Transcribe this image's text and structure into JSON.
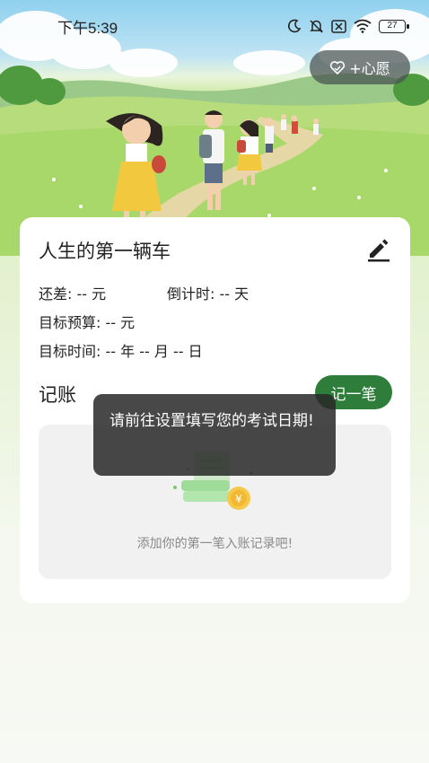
{
  "status_bar": {
    "time": "下午5:39",
    "battery": "27",
    "icons": [
      "moon-icon",
      "bell-muted-icon",
      "sim-off-icon",
      "wifi-icon",
      "battery-icon"
    ]
  },
  "header": {
    "wish_button_label": "+心愿",
    "wish_icon": "heart-icon"
  },
  "goal": {
    "title": "人生的第一辆车",
    "edit_icon": "edit-icon",
    "remaining_label": "还差:",
    "remaining_value": "-- 元",
    "countdown_label": "倒计时:",
    "countdown_value": "-- 天",
    "budget_label": "目标预算:",
    "budget_value": "-- 元",
    "date_label": "目标时间:",
    "date_value": "-- 年 -- 月 -- 日"
  },
  "ledger": {
    "title": "记账",
    "record_button_label": "记一笔",
    "empty_text": "添加你的第一笔入账记录吧!",
    "empty_icon": "money-stack-icon"
  },
  "toast": {
    "message": "请前往设置填写您的考试日期!"
  },
  "colors": {
    "accent": "#2e7d3a",
    "toast_bg": "#282828",
    "card_bg": "#ffffff"
  }
}
